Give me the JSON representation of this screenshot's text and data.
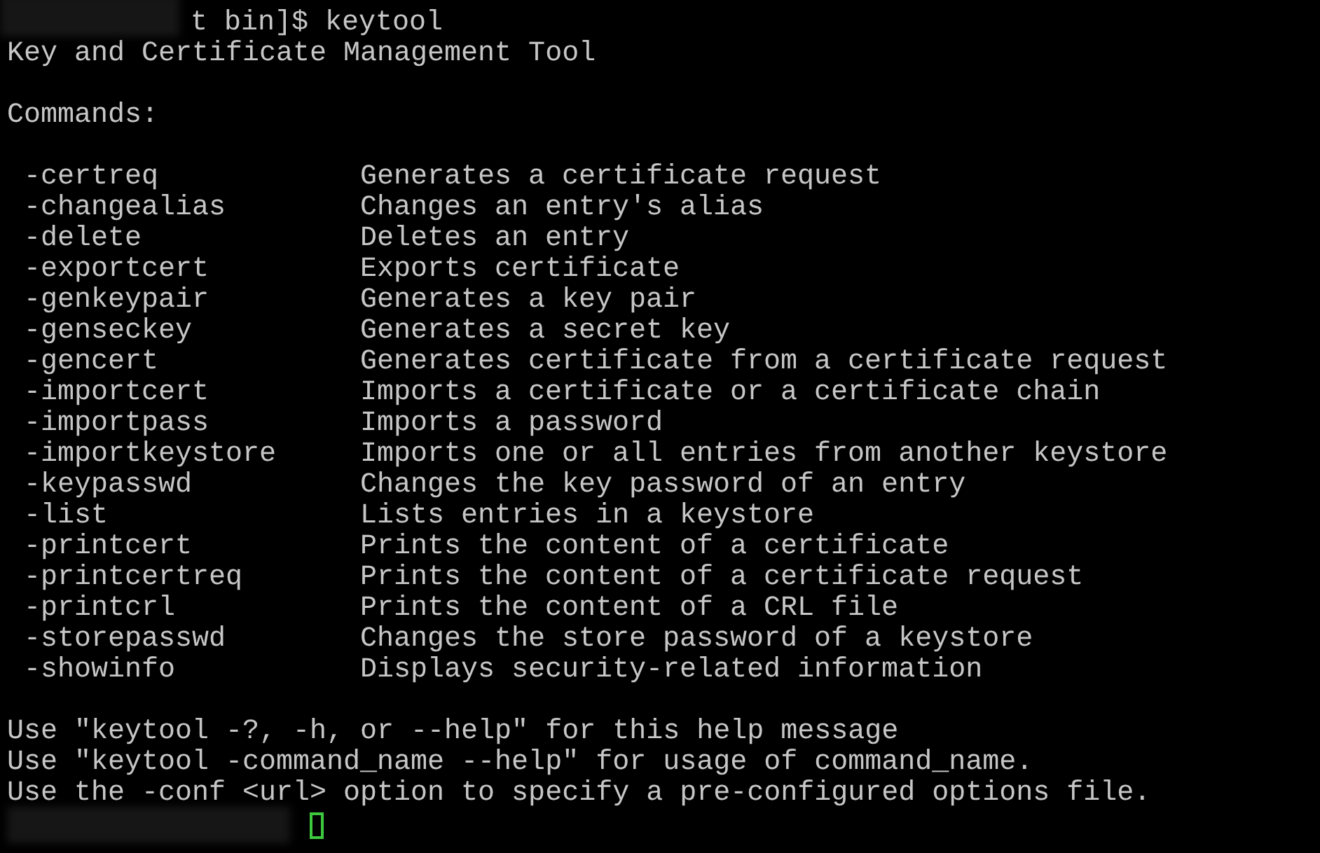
{
  "prompt": {
    "text": "t bin]$ keytool"
  },
  "title": "Key and Certificate Management Tool",
  "commands_heading": "Commands:",
  "commands": [
    {
      "name": "-certreq",
      "description": "Generates a certificate request"
    },
    {
      "name": "-changealias",
      "description": "Changes an entry's alias"
    },
    {
      "name": "-delete",
      "description": "Deletes an entry"
    },
    {
      "name": "-exportcert",
      "description": "Exports certificate"
    },
    {
      "name": "-genkeypair",
      "description": "Generates a key pair"
    },
    {
      "name": "-genseckey",
      "description": "Generates a secret key"
    },
    {
      "name": "-gencert",
      "description": "Generates certificate from a certificate request"
    },
    {
      "name": "-importcert",
      "description": "Imports a certificate or a certificate chain"
    },
    {
      "name": "-importpass",
      "description": "Imports a password"
    },
    {
      "name": "-importkeystore",
      "description": "Imports one or all entries from another keystore"
    },
    {
      "name": "-keypasswd",
      "description": "Changes the key password of an entry"
    },
    {
      "name": "-list",
      "description": "Lists entries in a keystore"
    },
    {
      "name": "-printcert",
      "description": "Prints the content of a certificate"
    },
    {
      "name": "-printcertreq",
      "description": "Prints the content of a certificate request"
    },
    {
      "name": "-printcrl",
      "description": "Prints the content of a CRL file"
    },
    {
      "name": "-storepasswd",
      "description": "Changes the store password of a keystore"
    },
    {
      "name": "-showinfo",
      "description": "Displays security-related information"
    }
  ],
  "footer_lines": [
    "Use \"keytool -?, -h, or --help\" for this help message",
    "Use \"keytool -command_name --help\" for usage of command_name.",
    "Use the -conf <url> option to specify a pre-configured options file."
  ]
}
